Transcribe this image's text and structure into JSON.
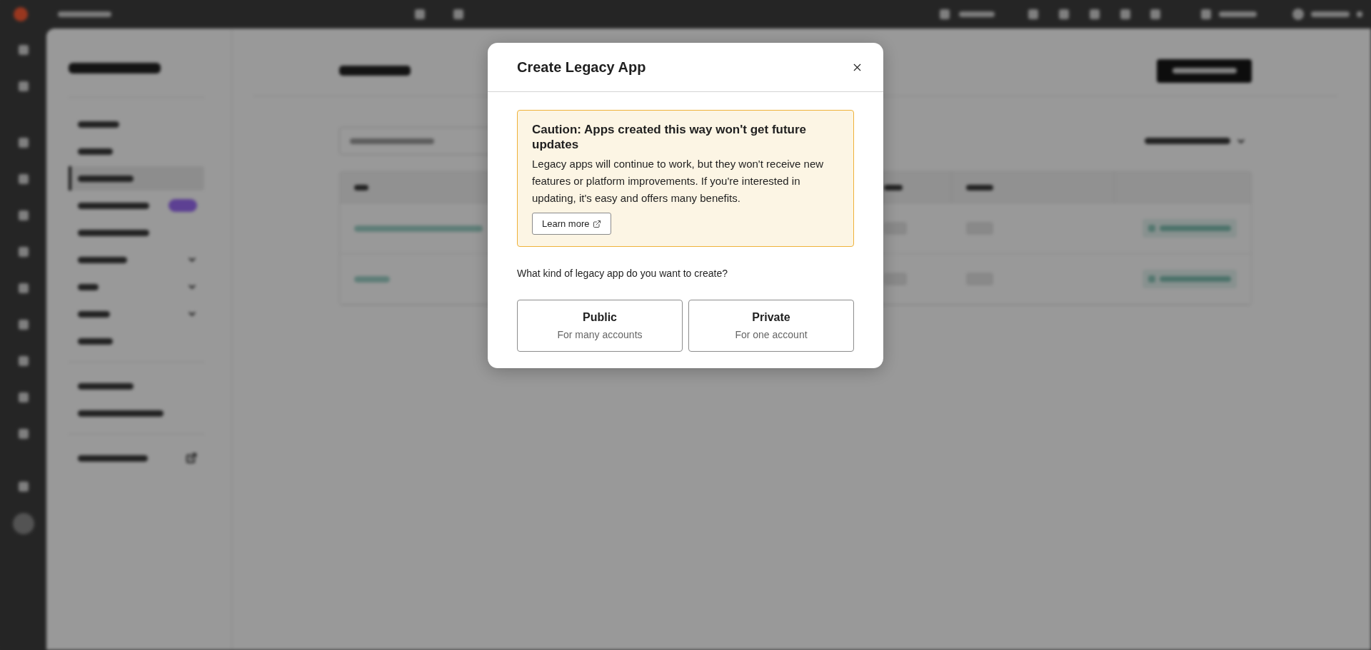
{
  "sidebar": {
    "sections": [
      {
        "items": [
          {
            "kind": "plain",
            "selected": false
          },
          {
            "kind": "plain",
            "selected": false
          },
          {
            "kind": "plain",
            "selected": true
          },
          {
            "kind": "badge",
            "selected": false
          },
          {
            "kind": "plain",
            "selected": false
          },
          {
            "kind": "expandable",
            "selected": false
          },
          {
            "kind": "expandable",
            "selected": false
          },
          {
            "kind": "expandable",
            "selected": false
          },
          {
            "kind": "plain",
            "selected": false
          }
        ]
      },
      {
        "items": [
          {
            "kind": "plain",
            "selected": false
          },
          {
            "kind": "plain",
            "selected": false
          }
        ]
      },
      {
        "items": [
          {
            "kind": "external",
            "selected": false
          }
        ]
      }
    ]
  },
  "modal": {
    "title": "Create Legacy App",
    "callout": {
      "title": "Caution: Apps created this way won't get future updates",
      "body": "Legacy apps will continue to work, but they won't receive new features or platform improvements. If you're interested in updating, it's easy and offers many benefits.",
      "link": "Learn more"
    },
    "question": "What kind of legacy app do you want to create?",
    "options": [
      {
        "title": "Public",
        "subtitle": "For many accounts"
      },
      {
        "title": "Private",
        "subtitle": "For one account"
      }
    ]
  }
}
